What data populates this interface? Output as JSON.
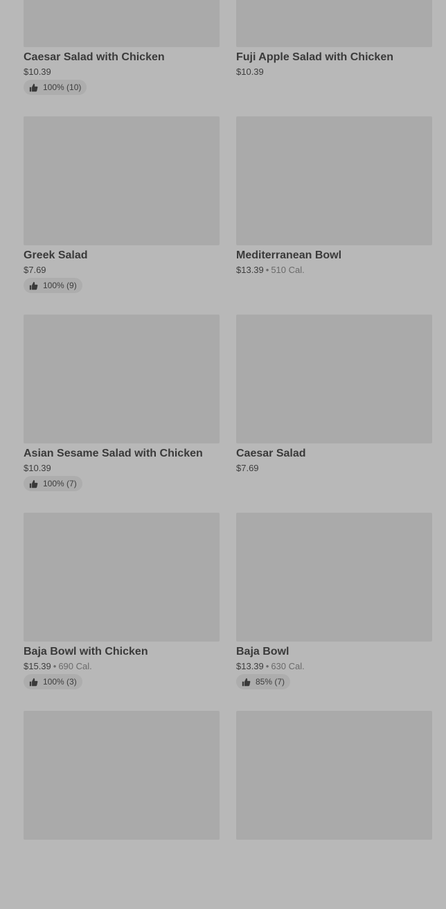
{
  "items": [
    {
      "name": "Caesar Salad with Chicken",
      "price": "$10.39",
      "calories": "",
      "rating": "100% (10)"
    },
    {
      "name": "Fuji Apple Salad with Chicken",
      "price": "$10.39",
      "calories": "",
      "rating": ""
    },
    {
      "name": "Greek Salad",
      "price": "$7.69",
      "calories": "",
      "rating": "100% (9)"
    },
    {
      "name": "Mediterranean Bowl",
      "price": "$13.39",
      "calories": "510 Cal.",
      "rating": ""
    },
    {
      "name": "Asian Sesame Salad with Chicken",
      "price": "$10.39",
      "calories": "",
      "rating": "100% (7)"
    },
    {
      "name": "Caesar Salad",
      "price": "$7.69",
      "calories": "",
      "rating": ""
    },
    {
      "name": "Baja Bowl with Chicken",
      "price": "$15.39",
      "calories": "690 Cal.",
      "rating": "100% (3)"
    },
    {
      "name": "Baja Bowl",
      "price": "$13.39",
      "calories": "630 Cal.",
      "rating": "85% (7)"
    },
    {
      "name": "",
      "price": "",
      "calories": "",
      "rating": ""
    },
    {
      "name": "",
      "price": "",
      "calories": "",
      "rating": ""
    }
  ],
  "meta_separator": "•",
  "icons": {
    "rating": "thumbs-up-icon"
  }
}
